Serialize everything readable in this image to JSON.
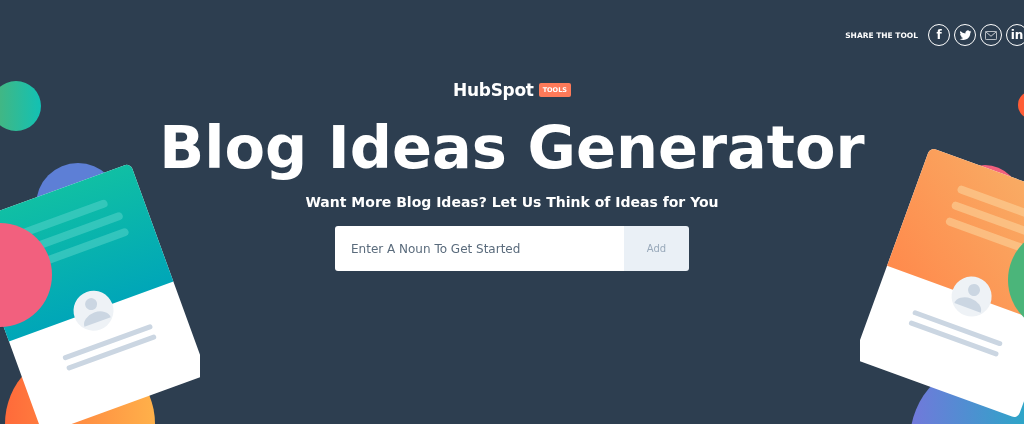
{
  "share": {
    "label": "SHARE THE TOOL",
    "facebook": "f",
    "linkedin": "in"
  },
  "logo": {
    "name": "HubSpot",
    "badge": "TOOLS"
  },
  "title": "Blog Ideas Generator",
  "subtitle": "Want More Blog Ideas? Let Us Think of Ideas for You",
  "search": {
    "placeholder": "Enter A Noun To Get Started",
    "button": "Add"
  }
}
